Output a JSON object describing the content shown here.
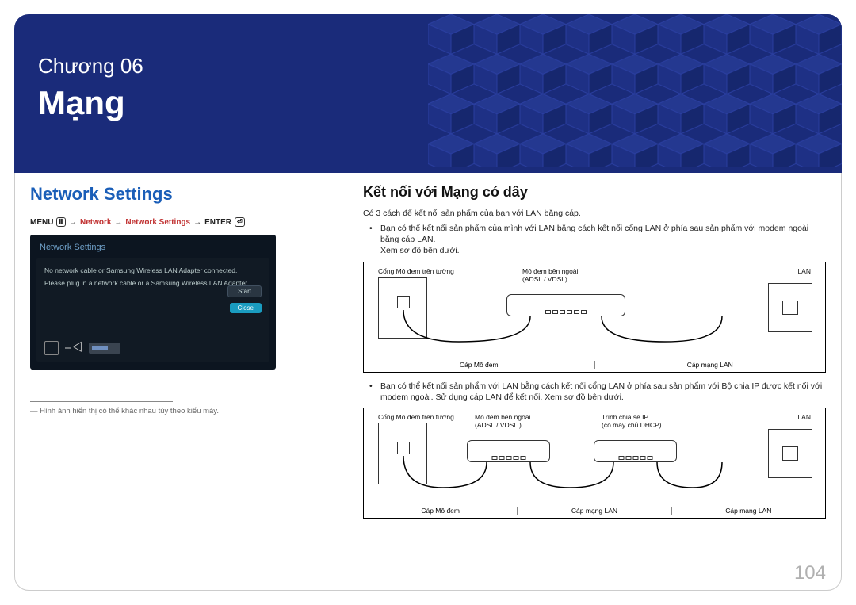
{
  "hero": {
    "chapter": "Chương 06",
    "title": "Mạng"
  },
  "left": {
    "section_title": "Network Settings",
    "breadcrumb": {
      "menu": "MENU",
      "network": "Network",
      "settings": "Network Settings",
      "enter": "ENTER"
    },
    "screenshot": {
      "header": "Network Settings",
      "line1": "No network cable or Samsung Wireless LAN Adapter connected.",
      "line2": "Please plug in a network cable or a Samsung Wireless LAN Adapter.",
      "start": "Start",
      "close": "Close"
    },
    "footnote": "―  Hình ảnh hiển thị có thể khác nhau tùy theo kiểu máy."
  },
  "right": {
    "title": "Kết nối với Mạng có dây",
    "intro": "Có 3 cách để kết nối sản phẩm của bạn với LAN bằng cáp.",
    "bullet1_a": "Bạn có thể kết nối sản phẩm của mình với LAN bằng cách kết nối cổng LAN ở phía sau sản phẩm với modem ngoài bằng cáp LAN.",
    "bullet1_b": "Xem sơ đồ bên dưới.",
    "bullet2": "Bạn có thể kết nối sản phẩm với LAN bằng cách kết nối cổng LAN ở phía sau sản phẩm với Bộ chia IP được kết nối với modem ngoài. Sử dụng cáp LAN để kết nối. Xem sơ đồ bên dưới.",
    "diagram1": {
      "wall_label": "Cổng Mô đem trên tường",
      "modem_label_1": "Mô đem bên ngoài",
      "modem_label_2": "(ADSL / VDSL)",
      "lan": "LAN",
      "sub1": "Cáp Mô đem",
      "sub2": "Cáp mạng LAN"
    },
    "diagram2": {
      "wall_label": "Cổng Mô đem trên tường",
      "modem_label_1": "Mô đem bên ngoài",
      "modem_label_2": "(ADSL / VDSL )",
      "router_label_1": "Trình chia sẻ IP",
      "router_label_2": "(có máy chủ DHCP)",
      "lan": "LAN",
      "sub1": "Cáp Mô đem",
      "sub2": "Cáp mạng LAN",
      "sub3": "Cáp mạng LAN"
    }
  },
  "page_number": "104"
}
